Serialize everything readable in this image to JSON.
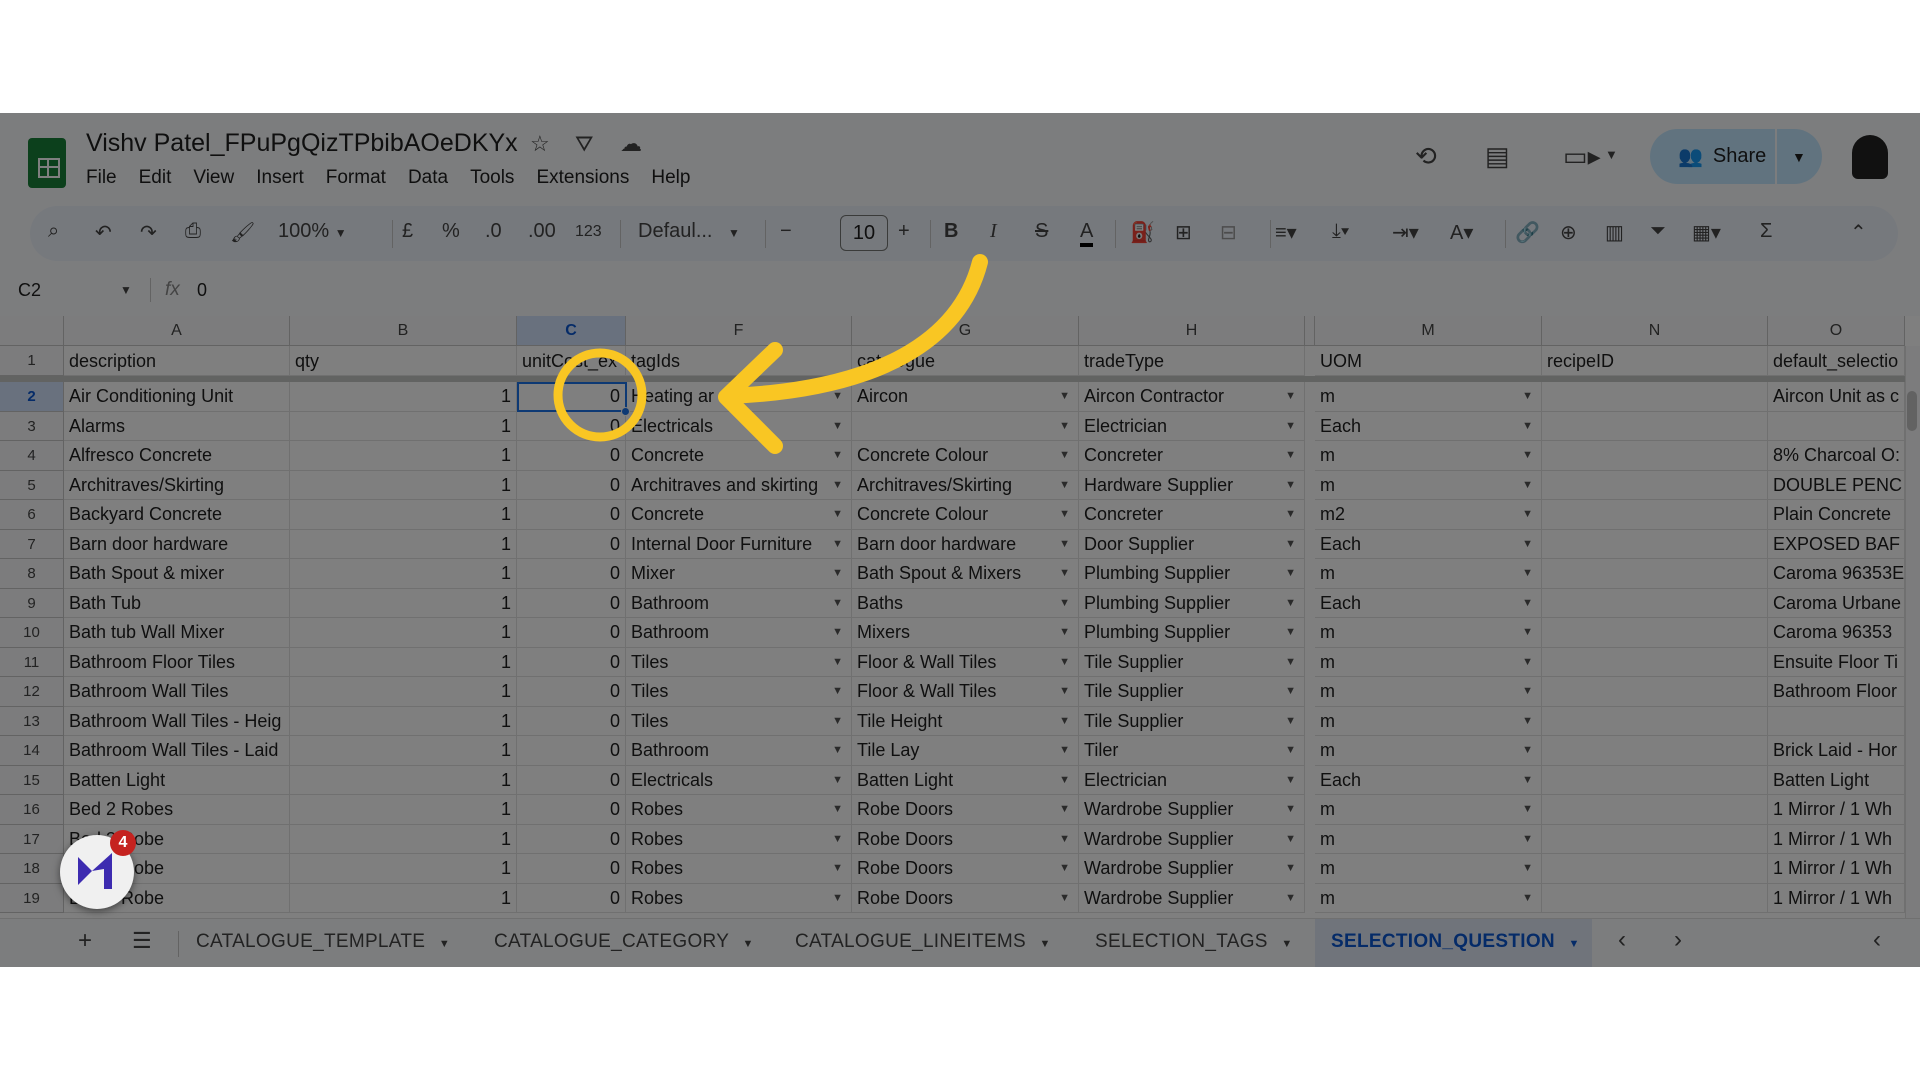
{
  "app": {
    "title": "Vishv Patel_FPuPgQizTPbibAOeDKYx",
    "menu": [
      "File",
      "Edit",
      "View",
      "Insert",
      "Format",
      "Data",
      "Tools",
      "Extensions",
      "Help"
    ],
    "share_label": "Share"
  },
  "toolbar": {
    "zoom": "100%",
    "currency": "£",
    "percent": "%",
    "dec_decrease": ".0",
    "dec_increase": ".00",
    "number_format": "123",
    "font": "Defaul...",
    "font_size": "10",
    "bold": "B",
    "italic": "I",
    "strike": "S",
    "text_color": "A"
  },
  "formula_bar": {
    "cell_ref": "C2",
    "fx": "fx",
    "value": "0"
  },
  "columns": [
    "A",
    "B",
    "C",
    "F",
    "G",
    "H",
    "M",
    "N",
    "O"
  ],
  "rows": [
    {
      "n": "1",
      "cells": [
        "description",
        "qty",
        "unitCost_ex",
        "tagIds",
        "catalogue",
        "tradeType",
        "UOM",
        "recipeID",
        "default_selectio"
      ]
    },
    {
      "n": "2",
      "cells": [
        "Air Conditioning Unit",
        "1",
        "0",
        "Heating ar",
        "Aircon",
        "Aircon Contractor",
        "m",
        "",
        "Aircon Unit as c"
      ]
    },
    {
      "n": "3",
      "cells": [
        "Alarms",
        "1",
        "0",
        "Electricals",
        "",
        "Electrician",
        "Each",
        "",
        ""
      ]
    },
    {
      "n": "4",
      "cells": [
        "Alfresco Concrete",
        "1",
        "0",
        "Concrete",
        "Concrete Colour",
        "Concreter",
        "m",
        "",
        "8% Charcoal O:"
      ]
    },
    {
      "n": "5",
      "cells": [
        "Architraves/Skirting",
        "1",
        "0",
        "Architraves and skirting",
        "Architraves/Skirting",
        "Hardware Supplier",
        "m",
        "",
        "DOUBLE PENC"
      ]
    },
    {
      "n": "6",
      "cells": [
        "Backyard Concrete",
        "1",
        "0",
        "Concrete",
        "Concrete Colour",
        "Concreter",
        "m2",
        "",
        "Plain Concrete"
      ]
    },
    {
      "n": "7",
      "cells": [
        "Barn door hardware",
        "1",
        "0",
        "Internal Door Furniture",
        "Barn door hardware",
        "Door Supplier",
        "Each",
        "",
        "EXPOSED BAF"
      ]
    },
    {
      "n": "8",
      "cells": [
        "Bath Spout & mixer",
        "1",
        "0",
        "Mixer",
        "Bath Spout & Mixers",
        "Plumbing Supplier",
        "m",
        "",
        "Caroma 96353E"
      ]
    },
    {
      "n": "9",
      "cells": [
        "Bath Tub",
        "1",
        "0",
        "Bathroom",
        "Baths",
        "Plumbing Supplier",
        "Each",
        "",
        "Caroma Urbane"
      ]
    },
    {
      "n": "10",
      "cells": [
        "Bath tub Wall Mixer",
        "1",
        "0",
        "Bathroom",
        "Mixers",
        "Plumbing Supplier",
        "m",
        "",
        " Caroma 96353"
      ]
    },
    {
      "n": "11",
      "cells": [
        "Bathroom Floor Tiles",
        "1",
        "0",
        "Tiles",
        "Floor & Wall Tiles",
        "Tile Supplier",
        "m",
        "",
        "Ensuite Floor Ti"
      ]
    },
    {
      "n": "12",
      "cells": [
        "Bathroom Wall Tiles",
        "1",
        "0",
        "Tiles",
        "Floor & Wall Tiles",
        "Tile Supplier",
        "m",
        "",
        "Bathroom Floor"
      ]
    },
    {
      "n": "13",
      "cells": [
        "Bathroom Wall Tiles - Heig",
        "1",
        "0",
        "Tiles",
        "Tile Height",
        "Tile Supplier",
        "m",
        "",
        ""
      ]
    },
    {
      "n": "14",
      "cells": [
        "Bathroom Wall Tiles - Laid",
        "1",
        "0",
        "Bathroom",
        "Tile Lay",
        "Tiler",
        "m",
        "",
        "Brick Laid - Hor"
      ]
    },
    {
      "n": "15",
      "cells": [
        "Batten Light",
        "1",
        "0",
        "Electricals",
        "Batten Light",
        "Electrician",
        "Each",
        "",
        "Batten Light"
      ]
    },
    {
      "n": "16",
      "cells": [
        "Bed 2 Robes",
        "1",
        "0",
        "Robes",
        "Robe Doors",
        "Wardrobe Supplier",
        "m",
        "",
        " 1 Mirror / 1 Wh"
      ]
    },
    {
      "n": "17",
      "cells": [
        "Bed 3 Robe",
        "1",
        "0",
        "Robes",
        "Robe Doors",
        "Wardrobe Supplier",
        "m",
        "",
        " 1 Mirror / 1 Wh"
      ]
    },
    {
      "n": "18",
      "cells": [
        "Bed 4 Robe",
        "1",
        "0",
        "Robes",
        "Robe Doors",
        "Wardrobe Supplier",
        "m",
        "",
        " 1 Mirror / 1 Wh"
      ]
    },
    {
      "n": "19",
      "cells": [
        "Bed 5 Robe",
        "1",
        "0",
        "Robes",
        "Robe Doors",
        "Wardrobe Supplier",
        "m",
        "",
        " 1 Mirror / 1 Wh"
      ]
    }
  ],
  "sheet_tabs": [
    "CATALOGUE_TEMPLATE",
    "CATALOGUE_CATEGORY",
    "CATALOGUE_LINEITEMS",
    "SELECTION_TAGS",
    "SELECTION_QUESTION"
  ],
  "active_tab": "SELECTION_QUESTION",
  "overlay": {
    "badge_count": "4",
    "logo_text": "M",
    "annotation_color": "#f9c623"
  }
}
